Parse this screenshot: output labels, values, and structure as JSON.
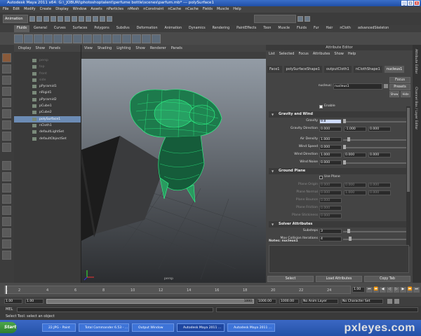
{
  "titlebar": {
    "title": "Autodesk Maya 2011 x64: G:\\_JOBURI\\photoshoptalent\\perfume bottle\\scenes\\parfum.mb* --- polySurface1"
  },
  "menubar": {
    "items": [
      "File",
      "Edit",
      "Modify",
      "Create",
      "Display",
      "Window",
      "Assets",
      "nParticles",
      "nMesh",
      "nConstraint",
      "nCache",
      "nCache",
      "Fields",
      "Muscle",
      "Help"
    ]
  },
  "statusline": {
    "mode": "Animation"
  },
  "shelf_tabs": [
    "Fluids",
    "General",
    "Curves",
    "Surfaces",
    "Polygons",
    "Subdivs",
    "Deformation",
    "Animation",
    "Dynamics",
    "Rendering",
    "PaintEffects",
    "Toon",
    "Muscle",
    "Fluids",
    "Fur",
    "Hair",
    "nCloth",
    "advancedSkeleton"
  ],
  "outliner": {
    "menu": [
      "Display",
      "Show",
      "Panels"
    ],
    "items": [
      {
        "label": "persp",
        "dim": true
      },
      {
        "label": "top",
        "dim": true
      },
      {
        "label": "front",
        "dim": true
      },
      {
        "label": "side",
        "dim": true
      },
      {
        "label": "pPyramid1",
        "dim": false
      },
      {
        "label": "nRigid1",
        "dim": false
      },
      {
        "label": "pPyramid2",
        "dim": false
      },
      {
        "label": "pCube1",
        "dim": false
      },
      {
        "label": "pCube2",
        "dim": false
      },
      {
        "label": "polySurface1",
        "dim": false,
        "selected": true
      },
      {
        "label": "nCloth1",
        "dim": false
      },
      {
        "label": "defaultLightSet",
        "dim": false
      },
      {
        "label": "defaultObjectSet",
        "dim": false
      }
    ]
  },
  "viewport": {
    "menu": [
      "View",
      "Shading",
      "Lighting",
      "Show",
      "Renderer",
      "Panels"
    ],
    "camera_label": "persp"
  },
  "attribute_editor": {
    "title": "Attribute Editor",
    "menu": [
      "List",
      "Selected",
      "Focus",
      "Attributes",
      "Show",
      "Help"
    ],
    "tabs": [
      "Face1",
      "polySurfaceShape1",
      "outputCloth1",
      "nClothShape1",
      "nucleus1"
    ],
    "node_label": "nucleus:",
    "node_value": "nucleus1",
    "buttons": {
      "focus": "Focus",
      "presets": "Presets",
      "show": "Show",
      "hide": "Hide"
    },
    "enable_label": "Enable",
    "sections": {
      "gravity": "Gravity and Wind",
      "ground": "Ground Plane",
      "solver": "Solver Attributes"
    },
    "gravity_fields": [
      {
        "label": "Gravity",
        "values": [
          "9.8"
        ]
      },
      {
        "label": "Gravity Direction",
        "values": [
          "0.000",
          "-1.000",
          "0.000"
        ]
      },
      {
        "label": "Air Density",
        "values": [
          "1.000"
        ]
      },
      {
        "label": "Wind Speed",
        "values": [
          "0.000"
        ]
      },
      {
        "label": "Wind Direction",
        "values": [
          "1.000",
          "0.000",
          "0.000"
        ]
      },
      {
        "label": "Wind Noise",
        "values": [
          "0.000"
        ]
      }
    ],
    "use_plane_label": "Use Plane",
    "ground_fields": [
      {
        "label": "Plane Origin",
        "values": [
          "0.000",
          "0.000",
          "0.000"
        ]
      },
      {
        "label": "Plane Normal",
        "values": [
          "0.000",
          "1.000",
          "0.000"
        ]
      },
      {
        "label": "Plane Bounce",
        "values": [
          "0.000"
        ]
      },
      {
        "label": "Plane Friction",
        "values": [
          "0.000"
        ]
      },
      {
        "label": "Plane Stickiness",
        "values": [
          "0.000"
        ]
      }
    ],
    "solver_fields": [
      {
        "label": "Substeps",
        "values": [
          "3"
        ]
      },
      {
        "label": "Max Collision Iterations",
        "values": [
          "4"
        ]
      }
    ],
    "notes_label": "Notes: nucleus1",
    "bottom_buttons": [
      "Select",
      "Load Attributes",
      "Copy Tab"
    ]
  },
  "side_tabs": [
    "Attribute Editor",
    "Channel Box / Layer Editor"
  ],
  "timeslider": {
    "ticks": [
      "1",
      "2",
      "4",
      "6",
      "8",
      "10",
      "12",
      "14",
      "16",
      "18",
      "20",
      "22",
      "24"
    ],
    "current_frame": "1.00"
  },
  "rangeslider": {
    "start": "1.00",
    "start2": "1.00",
    "range_label": "1000",
    "end": "1000.00",
    "end2": "1000.00",
    "anim_layer": "No Anim Layer",
    "char_set": "No Character Set"
  },
  "cmdline": {
    "label": "MEL"
  },
  "helpline": {
    "text": "Select Tool: select an object"
  },
  "taskbar": {
    "start": "Start",
    "tasks": [
      "22.JPG - Paint",
      "Total Commander 6.53 - ...",
      "Output Window",
      "Autodesk Maya 2011 ...",
      "Autodesk Maya 2011 ..."
    ]
  },
  "watermark": "pxleyes.com"
}
